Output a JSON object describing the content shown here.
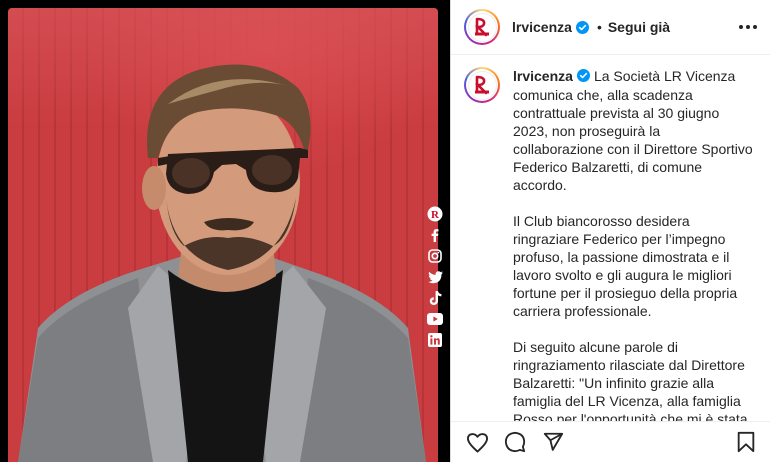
{
  "post": {
    "username": "lrvicenza",
    "follow_status": "Segui già",
    "separator": "•"
  },
  "caption": {
    "username": "lrvicenza",
    "paragraphs": [
      "La Società LR Vicenza comunica che, alla scadenza contrattuale prevista al 30 giugno 2023, non proseguirà la collaborazione con il Direttore Sportivo Federico Balzaretti, di comune accordo.",
      "Il Club biancorosso desidera ringraziare Federico per l’impegno profuso, la passione dimostrata e il lavoro svolto e gli augura le migliori fortune per il prosieguo della propria carriera professionale.",
      "Di seguito alcune parole di ringraziamento rilasciate dal Direttore Balzaretti: \"Un infinito grazie alla famiglia del LR Vicenza, alla famiglia Rosso per l'opportunità che mi è stata data, alla squadra, agli allenatori, al"
    ]
  },
  "media": {
    "social_icons": [
      "lr-vicenza-logo-icon",
      "facebook-icon",
      "instagram-icon",
      "twitter-icon",
      "tiktok-icon",
      "youtube-icon",
      "linkedin-icon"
    ]
  },
  "actions": [
    "like-icon",
    "comment-icon",
    "share-icon",
    "bookmark-icon"
  ],
  "colors": {
    "verified_blue": "#0095f6",
    "text": "#262626",
    "background_red": "#c43a3e"
  }
}
